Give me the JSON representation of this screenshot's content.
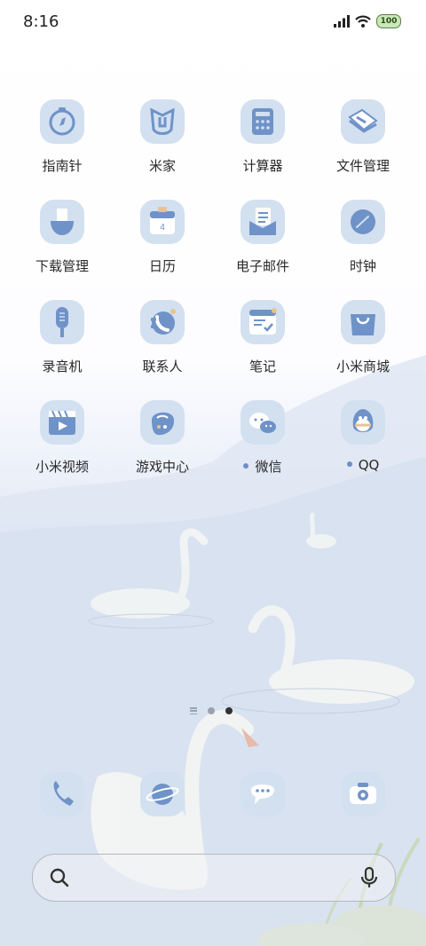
{
  "status_bar": {
    "time": "8:16",
    "battery": "100"
  },
  "apps": [
    {
      "label": "指南针",
      "icon": "compass-icon",
      "dot": false
    },
    {
      "label": "米家",
      "icon": "mijia-icon",
      "dot": false
    },
    {
      "label": "计算器",
      "icon": "calculator-icon",
      "dot": false
    },
    {
      "label": "文件管理",
      "icon": "file-manager-icon",
      "dot": false
    },
    {
      "label": "下载管理",
      "icon": "download-icon",
      "dot": false
    },
    {
      "label": "日历",
      "icon": "calendar-icon",
      "dot": false,
      "calendar_day": "4"
    },
    {
      "label": "电子邮件",
      "icon": "email-icon",
      "dot": false
    },
    {
      "label": "时钟",
      "icon": "clock-icon",
      "dot": false
    },
    {
      "label": "录音机",
      "icon": "recorder-icon",
      "dot": false
    },
    {
      "label": "联系人",
      "icon": "contacts-icon",
      "dot": false
    },
    {
      "label": "笔记",
      "icon": "notes-icon",
      "dot": false
    },
    {
      "label": "小米商城",
      "icon": "mi-store-icon",
      "dot": false
    },
    {
      "label": "小米视频",
      "icon": "video-icon",
      "dot": false
    },
    {
      "label": "游戏中心",
      "icon": "game-center-icon",
      "dot": false
    },
    {
      "label": "微信",
      "icon": "wechat-icon",
      "dot": true
    },
    {
      "label": "QQ",
      "icon": "qq-icon",
      "dot": true
    }
  ],
  "dock": [
    {
      "icon": "phone-icon"
    },
    {
      "icon": "browser-icon"
    },
    {
      "icon": "messages-icon"
    },
    {
      "icon": "camera-icon"
    }
  ],
  "colors": {
    "icon_bg": "#d3e0f0",
    "icon_fg": "#6f93c8",
    "notification_dot": "#6c8fc9"
  }
}
